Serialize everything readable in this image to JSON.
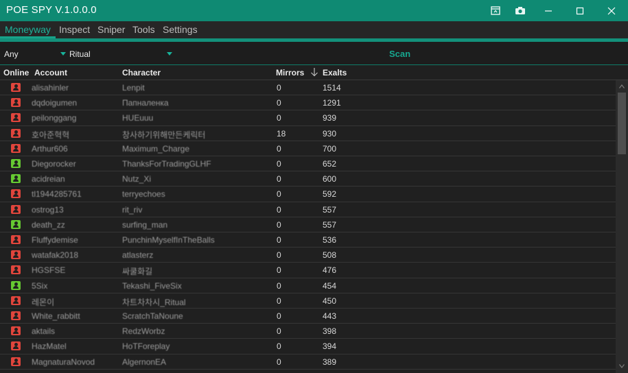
{
  "window": {
    "title": "POE SPY V.1.0.0.0"
  },
  "titlebar_icons": [
    "collapse-icon",
    "camera-icon"
  ],
  "menu": {
    "items": [
      {
        "label": "Moneyway",
        "active": true
      },
      {
        "label": "Inspect",
        "active": false
      },
      {
        "label": "Sniper",
        "active": false
      },
      {
        "label": "Tools",
        "active": false
      },
      {
        "label": "Settings",
        "active": false
      }
    ]
  },
  "filters": {
    "status": "Any",
    "league": "Ritual",
    "scan_label": "Scan"
  },
  "table": {
    "columns": {
      "online": "Online",
      "account": "Account",
      "character": "Character",
      "mirrors": "Mirrors",
      "exalts": "Exalts"
    },
    "sort_column": "Mirrors",
    "sort_direction": "descending",
    "rows": [
      {
        "online": false,
        "account": "alisahinler",
        "character": "Lenpit",
        "mirrors": "0",
        "exalts": "1514"
      },
      {
        "online": false,
        "account": "dqdoigumen",
        "character": "Папналенка",
        "mirrors": "0",
        "exalts": "1291"
      },
      {
        "online": false,
        "account": "peilonggang",
        "character": "HUEuuu",
        "mirrors": "0",
        "exalts": "939"
      },
      {
        "online": false,
        "account": "호아준혁혁",
        "character": "창사하기위해만든케릭터",
        "mirrors": "18",
        "exalts": "930"
      },
      {
        "online": false,
        "account": "Arthur606",
        "character": "Maximum_Charge",
        "mirrors": "0",
        "exalts": "700"
      },
      {
        "online": true,
        "account": "Diegorocker",
        "character": "ThanksForTradingGLHF",
        "mirrors": "0",
        "exalts": "652"
      },
      {
        "online": true,
        "account": "acidreian",
        "character": "Nutz_Xi",
        "mirrors": "0",
        "exalts": "600"
      },
      {
        "online": false,
        "account": "tl1944285761",
        "character": "terryechoes",
        "mirrors": "0",
        "exalts": "592"
      },
      {
        "online": false,
        "account": "ostrog13",
        "character": "rit_riv",
        "mirrors": "0",
        "exalts": "557"
      },
      {
        "online": true,
        "account": "death_zz",
        "character": "surfing_man",
        "mirrors": "0",
        "exalts": "557"
      },
      {
        "online": false,
        "account": "Fluffydemise",
        "character": "PunchinMyselfInTheBalls",
        "mirrors": "0",
        "exalts": "536"
      },
      {
        "online": false,
        "account": "watafak2018",
        "character": "atlasterz",
        "mirrors": "0",
        "exalts": "508"
      },
      {
        "online": false,
        "account": "HGSFSE",
        "character": "싸쿨화길",
        "mirrors": "0",
        "exalts": "476"
      },
      {
        "online": true,
        "account": "5Six",
        "character": "Tekashi_FiveSix",
        "mirrors": "0",
        "exalts": "454"
      },
      {
        "online": false,
        "account": "레몬이",
        "character": "차트차차시_Ritual",
        "mirrors": "0",
        "exalts": "450"
      },
      {
        "online": false,
        "account": "White_rabbitt",
        "character": "ScratchTaNoune",
        "mirrors": "0",
        "exalts": "443"
      },
      {
        "online": false,
        "account": "aktails",
        "character": "RedzWorbz",
        "mirrors": "0",
        "exalts": "398"
      },
      {
        "online": false,
        "account": "HazMatel",
        "character": "HoTForeplay",
        "mirrors": "0",
        "exalts": "394"
      },
      {
        "online": false,
        "account": "MagnaturaNovod",
        "character": "AlgernonEA",
        "mirrors": "0",
        "exalts": "389"
      }
    ]
  },
  "colors": {
    "accent": "#0f8a73",
    "accent_text": "#1fb39b",
    "offline": "#e0453c",
    "online": "#66c932",
    "background": "#202020"
  }
}
